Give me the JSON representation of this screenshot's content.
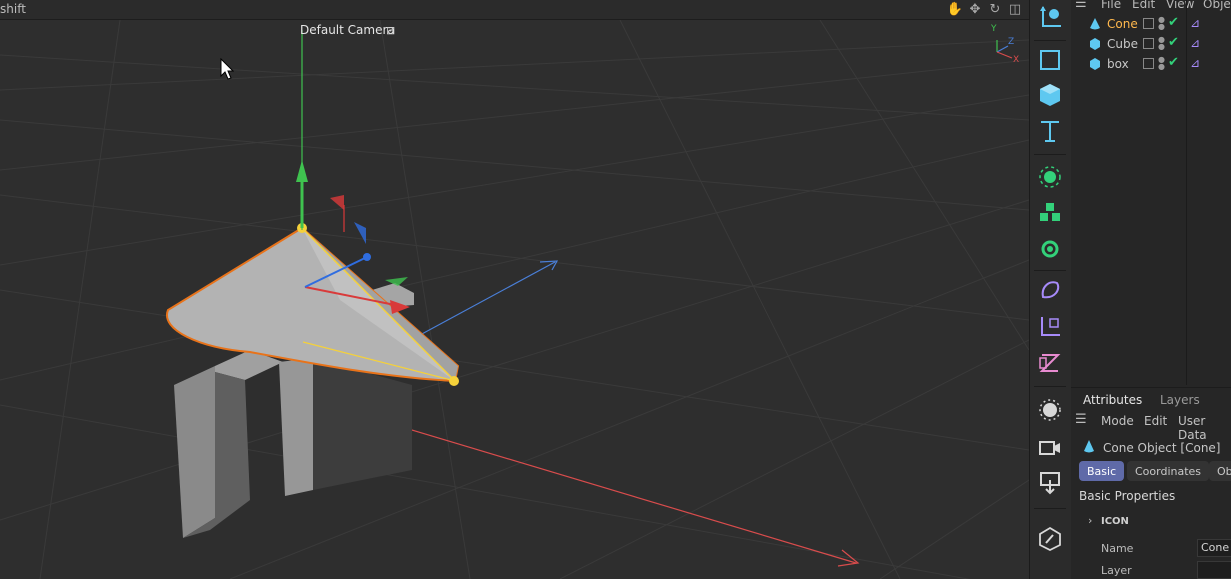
{
  "viewport": {
    "menu_text": "shift",
    "camera_label": "Default Camera",
    "camera_lock_glyph": "⊡",
    "nav_icons": [
      "hand-pan-icon",
      "move-camera-icon",
      "rotate-camera-icon",
      "maximize-icon"
    ],
    "axis_gizmo": {
      "y": "Y",
      "z": "Z",
      "x": "X"
    }
  },
  "toolbar": {
    "buttons": [
      "coordinate-system-icon",
      "rectangle-spline-icon",
      "cube-icon",
      "text-tool-icon",
      "subdivision-icon",
      "cloner-icon",
      "effector-icon",
      "deformer-icon",
      "axis-object-icon",
      "field-icon",
      "light-icon",
      "camera-icon",
      "render-icon",
      "edit-tool-icon"
    ]
  },
  "object_manager": {
    "menu": [
      "File",
      "Edit",
      "View",
      "Objec"
    ],
    "objects": [
      {
        "name": "Cone",
        "selected": true,
        "icon": "cone-icon"
      },
      {
        "name": "Cube",
        "selected": false,
        "icon": "cube-icon"
      },
      {
        "name": "box",
        "selected": false,
        "icon": "cube-icon"
      }
    ]
  },
  "attributes": {
    "tabs": [
      "Attributes",
      "Layers"
    ],
    "submenu": [
      "Mode",
      "Edit",
      "User Data"
    ],
    "object_title": "Cone Object [Cone]",
    "pills": [
      "Basic",
      "Coordinates",
      "Ob"
    ],
    "section": "Basic Properties",
    "group": "ICON",
    "fields": [
      {
        "label": "Name",
        "value": "Cone"
      },
      {
        "label": "Layer",
        "value": ""
      }
    ]
  },
  "colors": {
    "accent": "#f5a623",
    "selected_text": "#ffb84d",
    "cone_fill": "#b3b3b3",
    "outline": "#e8731a",
    "pill_active": "#5f6aa8",
    "icon_blue": "#5ec8f0",
    "icon_green": "#33d17a",
    "icon_purple": "#a78bfa"
  }
}
